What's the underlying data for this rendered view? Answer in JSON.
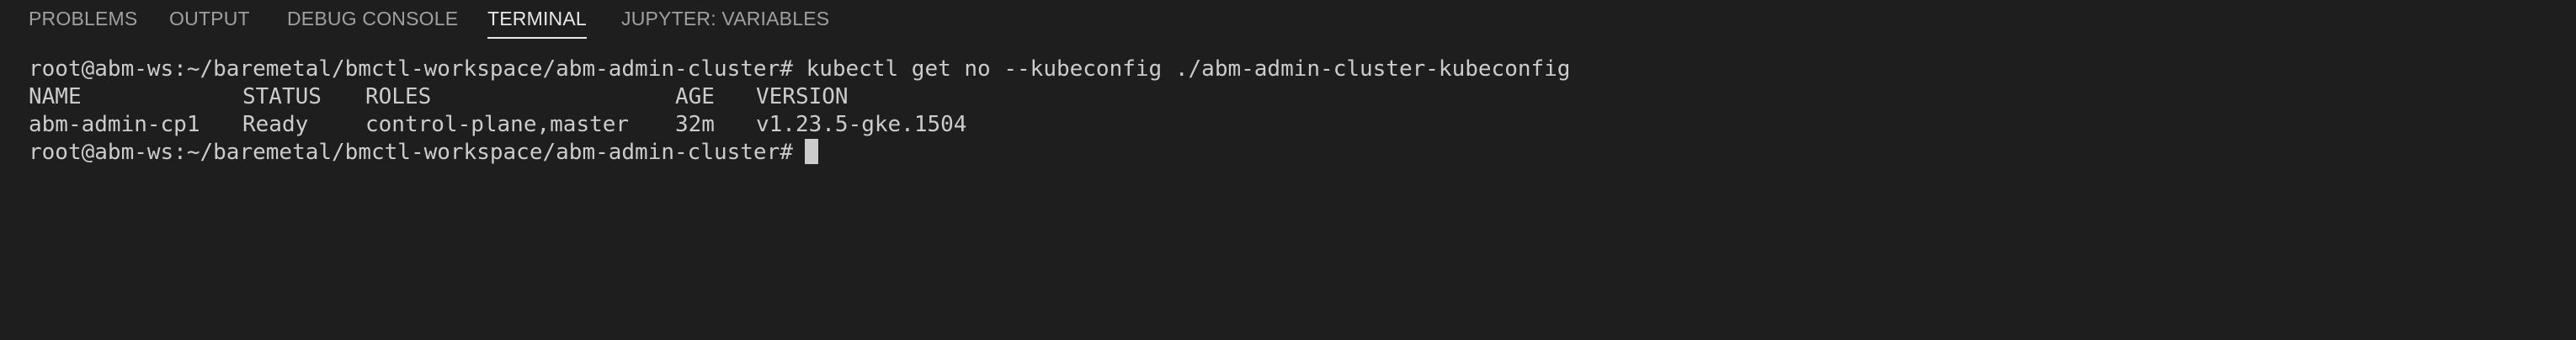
{
  "tabs": [
    {
      "label": "PROBLEMS"
    },
    {
      "label": "OUTPUT"
    },
    {
      "label": "DEBUG CONSOLE"
    },
    {
      "label": "TERMINAL"
    },
    {
      "label": "JUPYTER: VARIABLES"
    }
  ],
  "active_tab": "TERMINAL",
  "terminal": {
    "prompt": "root@abm-ws:~/baremetal/bmctl-workspace/abm-admin-cluster#",
    "command": "kubectl get no --kubeconfig ./abm-admin-cluster-kubeconfig",
    "headers": [
      "NAME",
      "STATUS",
      "ROLES",
      "AGE",
      "VERSION"
    ],
    "rows": [
      [
        "abm-admin-cp1",
        "Ready",
        "control-plane,master",
        "32m",
        "v1.23.5-gke.1504"
      ]
    ]
  }
}
